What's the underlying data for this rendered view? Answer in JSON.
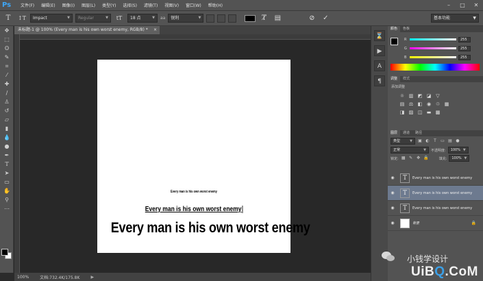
{
  "menubar": {
    "logo": "Ps",
    "items": [
      "文件(F)",
      "编辑(E)",
      "图像(I)",
      "图层(L)",
      "类型(Y)",
      "选择(S)",
      "滤镜(T)",
      "视图(V)",
      "窗口(W)",
      "帮助(H)"
    ],
    "window_controls": [
      "–",
      "□",
      "✕"
    ]
  },
  "options_bar": {
    "font_family": "Impact",
    "font_style": "Regular",
    "font_size": "18 点",
    "aa_label": "aa",
    "anti_alias": "锐利",
    "text_color": "#000000",
    "workspace": "基本功能"
  },
  "document": {
    "tab_title": "未标题-1 @ 100% (Every man is his own worst enemy, RGB/8) *",
    "tab_close": "×",
    "text_layers": [
      {
        "text": "Every man is his own worst enemy"
      },
      {
        "text": "Every man is his own worst enemy"
      },
      {
        "text": "Every man is his own worst enemy"
      }
    ]
  },
  "status_bar": {
    "zoom": "100%",
    "doc_info": "文档:732.4K/175.8K"
  },
  "color_panel": {
    "tabs": [
      "颜色",
      "色板"
    ],
    "channels": [
      {
        "label": "R",
        "value": "255"
      },
      {
        "label": "G",
        "value": "255"
      },
      {
        "label": "B",
        "value": "255"
      }
    ]
  },
  "adjustments_panel": {
    "tabs": [
      "调整",
      "样式"
    ],
    "title": "添加调整"
  },
  "layers_panel": {
    "tabs": [
      "图层",
      "通道",
      "路径"
    ],
    "kind_filter": "类型",
    "blend_mode": "正常",
    "opacity_label": "不透明度:",
    "opacity": "100%",
    "lock_label": "锁定:",
    "fill_label": "填充:",
    "fill": "100%",
    "layers": [
      {
        "name": "Every man is his own worst enemy",
        "kind": "text",
        "selected": false
      },
      {
        "name": "Every man is his own worst enemy",
        "kind": "text",
        "selected": true
      },
      {
        "name": "Every man is his own worst enemy",
        "kind": "text",
        "selected": false
      },
      {
        "name": "背景",
        "kind": "background",
        "selected": false
      }
    ]
  },
  "watermark": {
    "cn_text": "小钱学设计",
    "brand_prefix": "UiB",
    "brand_q": "Q",
    "brand_suffix": ".CoM"
  }
}
